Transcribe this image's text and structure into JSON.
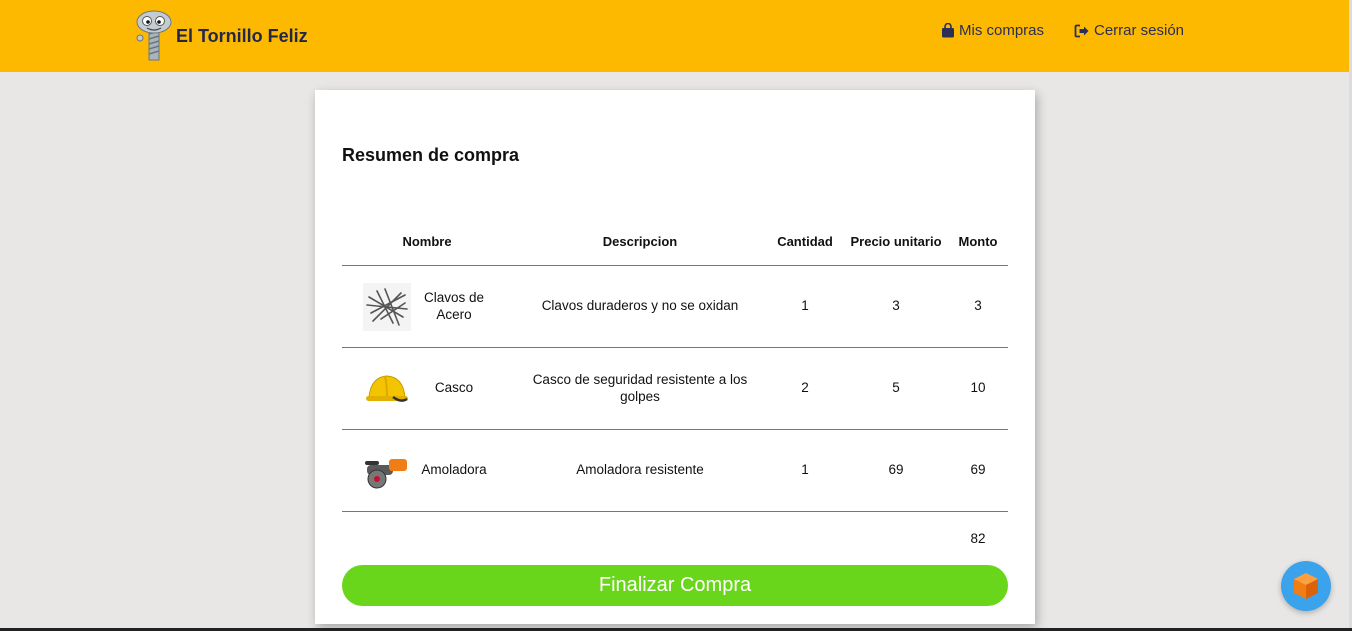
{
  "header": {
    "brand": "El Tornillo Feliz",
    "nav": [
      {
        "label": "Mis compras",
        "icon": "shopping-bag-icon"
      },
      {
        "label": "Cerrar sesión",
        "icon": "sign-out-icon"
      }
    ]
  },
  "summary": {
    "title": "Resumen de compra",
    "columns": [
      "Nombre",
      "Descripcion",
      "Cantidad",
      "Precio unitario",
      "Monto"
    ],
    "rows": [
      {
        "name": "Clavos de Acero",
        "description": "Clavos duraderos y no se oxidan",
        "quantity": "1",
        "unit_price": "3",
        "amount": "3",
        "icon": "nails-image"
      },
      {
        "name": "Casco",
        "description": "Casco de seguridad resistente a los golpes",
        "quantity": "2",
        "unit_price": "5",
        "amount": "10",
        "icon": "helmet-image"
      },
      {
        "name": "Amoladora",
        "description": "Amoladora resistente",
        "quantity": "1",
        "unit_price": "69",
        "amount": "69",
        "icon": "angle-grinder-image"
      }
    ],
    "total": "82",
    "finalize_label": "Finalizar Compra"
  },
  "colors": {
    "header": "#fdb900",
    "button": "#6ad61b",
    "fab": "#3aa3ec"
  }
}
